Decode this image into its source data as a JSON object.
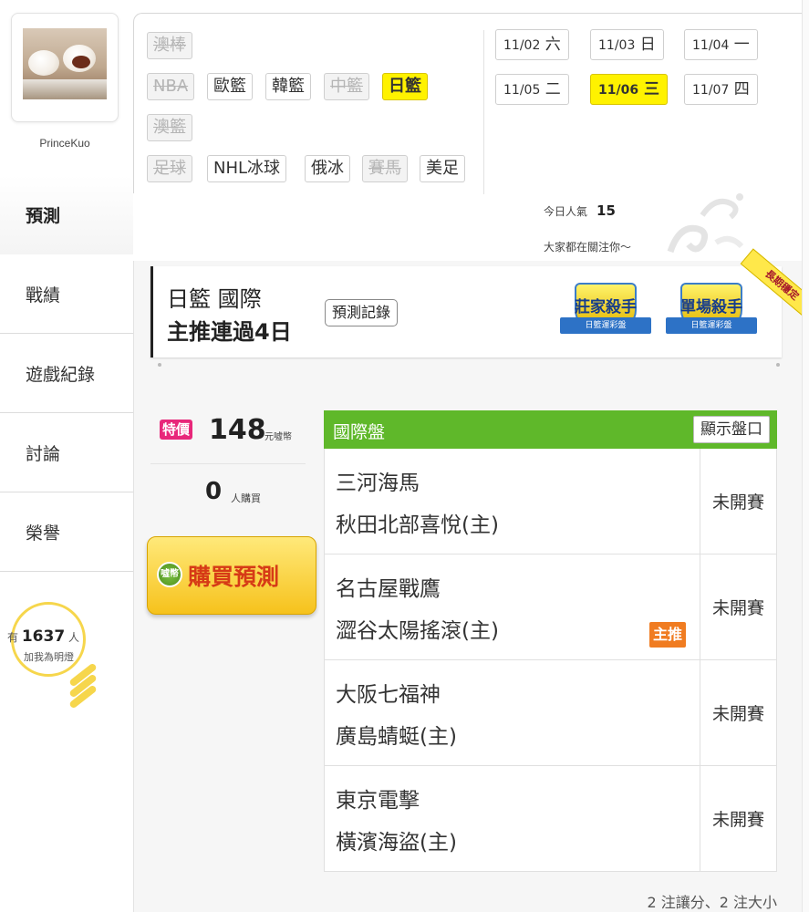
{
  "user": {
    "name": "PrinceKuo"
  },
  "nav": {
    "items": [
      {
        "label": "預測",
        "active": true
      },
      {
        "label": "戰績"
      },
      {
        "label": "遊戲紀錄"
      },
      {
        "label": "討論"
      },
      {
        "label": "榮譽"
      }
    ]
  },
  "followers": {
    "prefix": "有",
    "count": "1637",
    "suffix": "人",
    "caption": "加我為明燈"
  },
  "categories": [
    {
      "label": "澳棒",
      "state": "off"
    },
    {
      "label": "NBA",
      "state": "off"
    },
    {
      "label": "歐籃",
      "state": "normal"
    },
    {
      "label": "韓籃",
      "state": "normal"
    },
    {
      "label": "中籃",
      "state": "off"
    },
    {
      "label": "日籃",
      "state": "on"
    },
    {
      "label": "澳籃",
      "state": "off"
    },
    {
      "label": "足球",
      "state": "off"
    },
    {
      "label": "NHL冰球",
      "state": "normal"
    },
    {
      "label": "俄冰",
      "state": "normal"
    },
    {
      "label": "賽馬",
      "state": "off"
    },
    {
      "label": "美足",
      "state": "normal"
    }
  ],
  "dates": [
    {
      "date": "11/02",
      "weekday": "六"
    },
    {
      "date": "11/03",
      "weekday": "日"
    },
    {
      "date": "11/04",
      "weekday": "一"
    },
    {
      "date": "11/05",
      "weekday": "二"
    },
    {
      "date": "11/06",
      "weekday": "三",
      "selected": true
    },
    {
      "date": "11/07",
      "weekday": "四"
    }
  ],
  "popularity": {
    "label": "今日人氣",
    "value": "15",
    "note": "大家都在關注你～"
  },
  "header": {
    "league": "日籃 國際",
    "streak": "主推連過4日",
    "record_button": "預測記錄",
    "badges": [
      {
        "title": "莊家殺手",
        "sub": "日籃運彩盤"
      },
      {
        "title": "單場殺手",
        "sub": "日籃運彩盤"
      }
    ],
    "corner_ribbon": "長期穩定"
  },
  "price": {
    "tag": "特價",
    "amount": "148",
    "unit": "元噓幣",
    "buyers": "0",
    "buyers_unit": "人購買"
  },
  "buy_button": {
    "icon_text": "噓幣",
    "label": "購買預測"
  },
  "games": {
    "title": "國際盤",
    "show_odds_button": "顯示盤口",
    "rows": [
      {
        "away": "三河海馬",
        "home": "秋田北部喜悅(主)",
        "status": "未開賽"
      },
      {
        "away": "名古屋戰鷹",
        "home": "澀谷太陽搖滾(主)",
        "status": "未開賽",
        "tag": "主推"
      },
      {
        "away": "大阪七福神",
        "home": "廣島蜻蜓(主)",
        "status": "未開賽"
      },
      {
        "away": "東京電擊",
        "home": "橫濱海盜(主)",
        "status": "未開賽"
      }
    ],
    "footer": "2 注讓分、2 注大小"
  },
  "colors": {
    "selected": "#fff200",
    "green_header": "#5fb82a",
    "pick_tag": "#f07c21",
    "price_tag": "#e8277a",
    "bulb": "#f6d64c"
  }
}
